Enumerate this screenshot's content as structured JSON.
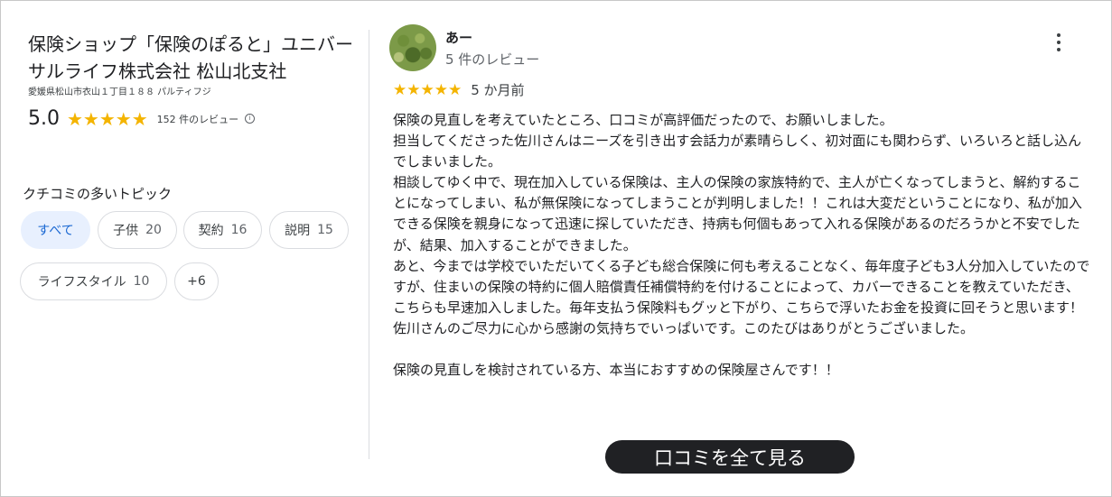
{
  "business": {
    "name": "保険ショップ「保険のぽると」ユニバーサルライフ株式会社 松山北支社",
    "address": "愛媛県松山市衣山１丁目１８８ パルティフジ",
    "rating": "5.0",
    "stars": "★★★★★",
    "review_count": "152 件のレビュー"
  },
  "topics": {
    "title": "クチコミの多いトピック",
    "chips": [
      {
        "label": "すべて",
        "count": ""
      },
      {
        "label": "子供",
        "count": "20"
      },
      {
        "label": "契約",
        "count": "16"
      },
      {
        "label": "説明",
        "count": "15"
      },
      {
        "label": "ライフスタイル",
        "count": "10"
      },
      {
        "label": "+6",
        "count": ""
      }
    ]
  },
  "review": {
    "author": "あー",
    "author_meta": "5 件のレビュー",
    "stars": "★★★★★",
    "time": "5 か月前",
    "paragraphs": [
      "保険の見直しを考えていたところ、口コミが高評価だったので、お願いしました。",
      "担当してくださった佐川さんはニーズを引き出す会話力が素晴らしく、初対面にも関わらず、いろいろと話し込んでしまいました。",
      "相談してゆく中で、現在加入している保険は、主人の保険の家族特約で、主人が亡くなってしまうと、解約することになってしまい、私が無保険になってしまうことが判明しました！！これは大変だということになり、私が加入できる保険を親身になって迅速に探していただき、持病も何個もあって入れる保険があるのだろうかと不安でしたが、結果、加入することができました。",
      "あと、今までは学校でいただいてくる子ども総合保険に何も考えることなく、毎年度子ども3人分加入していたのですが、住まいの保険の特約に個人賠償責任補償特約を付けることによって、カバーできることを教えていただき、こちらも早速加入しました。毎年支払う保険料もグッと下がり、こちらで浮いたお金を投資に回そうと思います！",
      "佐川さんのご尽力に心から感謝の気持ちでいっぱいです。このたびはありがとうございました。",
      "",
      "保険の見直しを検討されている方、本当におすすめの保険屋さんです！！"
    ]
  },
  "see_all_label": "口コミを全て見る",
  "colors": {
    "star": "#f4b400",
    "active_chip_bg": "#e8f0fe",
    "active_chip_text": "#1967d2",
    "button_bg": "#202124"
  }
}
